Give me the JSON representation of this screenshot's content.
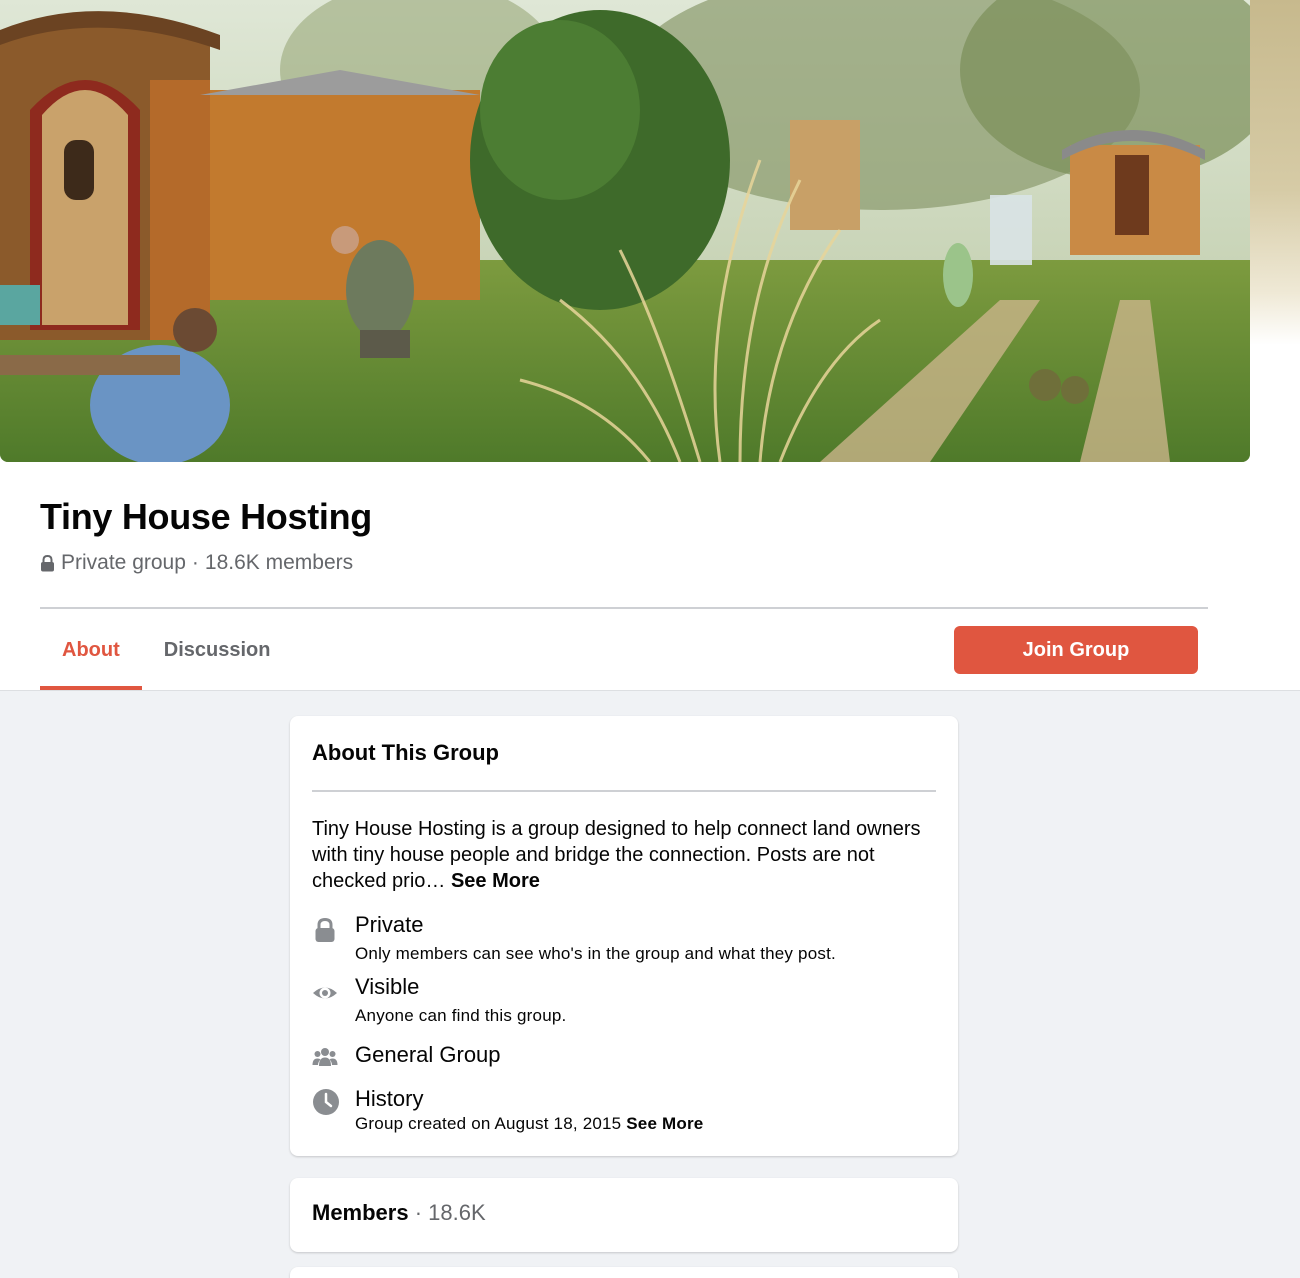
{
  "cover": {
    "alt_icon": "cover-photo"
  },
  "group": {
    "title": "Tiny House Hosting",
    "privacy": "Private group",
    "separator": "·",
    "members": "18.6K members"
  },
  "tabs": [
    {
      "label": "About",
      "active": true
    },
    {
      "label": "Discussion",
      "active": false
    }
  ],
  "join_button": "Join Group",
  "about": {
    "title": "About This Group",
    "description": "Tiny House Hosting is a group designed to help connect land owners with tiny house people and bridge the connection. Posts are not checked prio…",
    "see_more": "See More",
    "items": [
      {
        "icon": "lock-icon",
        "title": "Private",
        "subtitle": "Only members can see who's in the group and what they post."
      },
      {
        "icon": "eye-icon",
        "title": "Visible",
        "subtitle": "Anyone can find this group."
      },
      {
        "icon": "people-icon",
        "title": "General Group"
      },
      {
        "icon": "clock-icon",
        "title": "History",
        "subtitle": "Group created on August 18, 2015",
        "see_more": "See More"
      }
    ]
  },
  "members_card": {
    "label": "Members",
    "separator": "·",
    "count": "18.6K"
  },
  "colors": {
    "accent": "#e05640",
    "secondary_text": "#65676b",
    "page_bg": "#f0f2f5"
  }
}
